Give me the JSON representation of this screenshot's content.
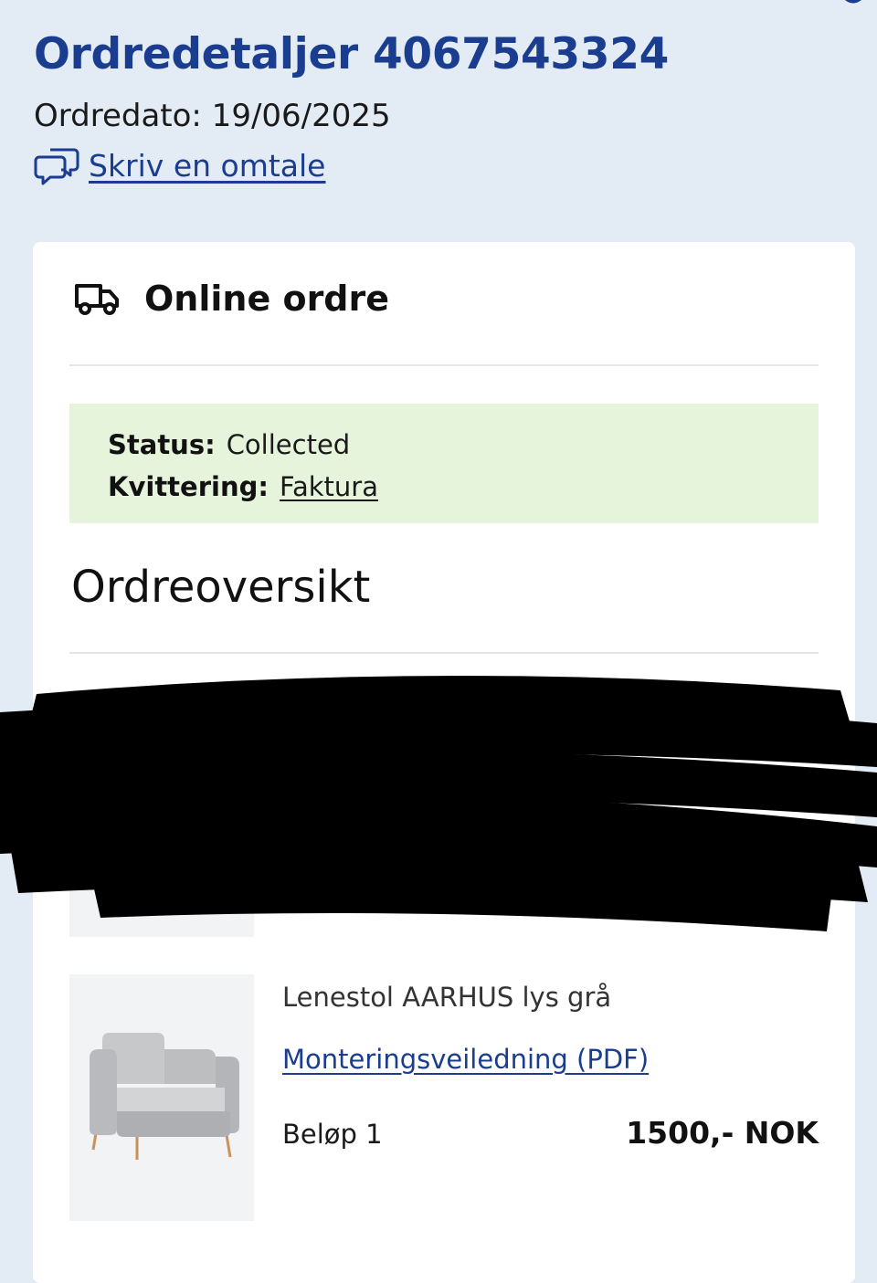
{
  "header": {
    "title": "Ordredetaljer 4067543324",
    "order_date": "Ordredato: 19/06/2025",
    "review_link": "Skriv en omtale"
  },
  "card": {
    "title": "Online ordre",
    "status_label": "Status:",
    "status_value": "Collected",
    "receipt_label": "Kvittering:",
    "receipt_link": "Faktura",
    "section_title": "Ordreoversikt"
  },
  "items": [
    {
      "name": "Lenestol AARHUS lys grå",
      "doc_link": "Monteringsveiledning (PDF)",
      "quantity": "Beløp 1",
      "price": "1500,- NOK"
    }
  ],
  "icons": {
    "review": "speech-bubbles-icon",
    "delivery": "truck-icon",
    "corner": "chevron-icon"
  },
  "colors": {
    "background": "#e3ebf4",
    "brand_blue": "#1a3d8f",
    "status_bg": "#e6f4dc",
    "card": "#ffffff"
  }
}
